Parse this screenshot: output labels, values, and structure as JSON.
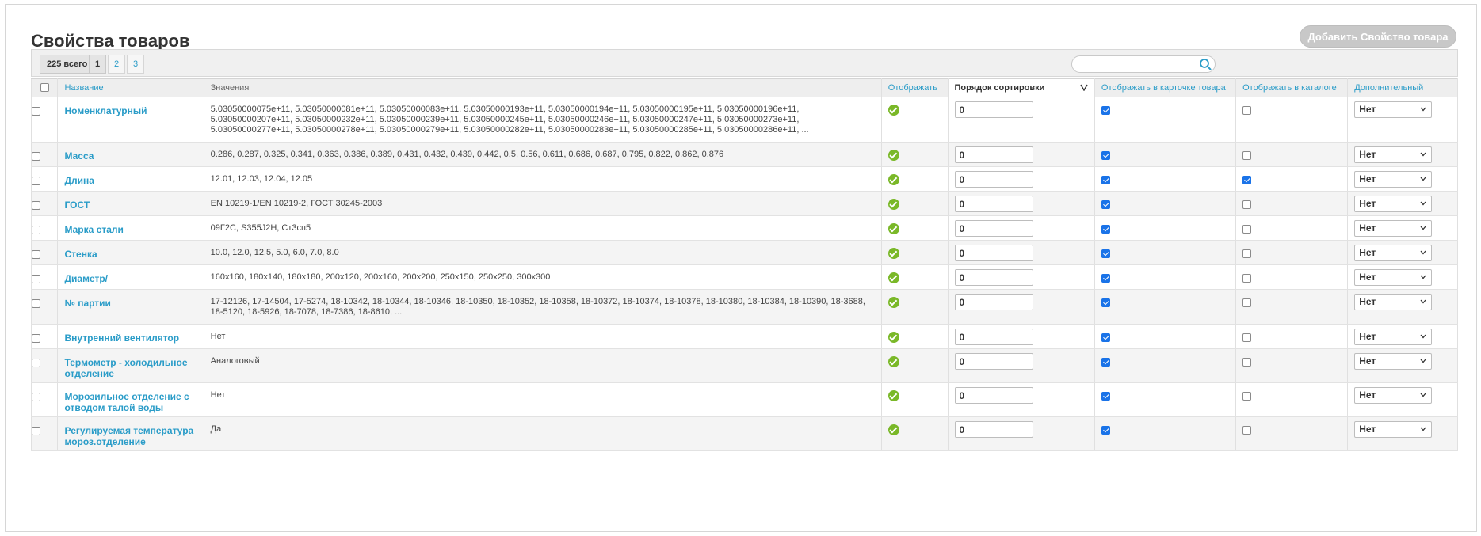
{
  "page": {
    "title": "Свойства товаров",
    "add_button": "Добавить Свойство товара"
  },
  "toolbar": {
    "total": "225 всего",
    "pages": [
      "1",
      "2",
      "3"
    ],
    "active_page": "1",
    "search_placeholder": ""
  },
  "columns": {
    "name": "Название",
    "values": "Значения",
    "show": "Отображать",
    "sort": "Порядок сортировки",
    "card": "Отображать в карточке товара",
    "catalog": "Отображать в каталоге",
    "extra": "Дополнительный"
  },
  "colors": {
    "link": "#2a9cc8",
    "ok": "#7ab828",
    "checkbox": "#1a73e8"
  },
  "rows": [
    {
      "name": [
        "Номенклатурный"
      ],
      "values": [
        "5.03050000075e+11, 5.03050000081e+11, 5.03050000083e+11, 5.03050000193e+11, 5.03050000194e+11, 5.03050000195e+11, 5.03050000196e+11,",
        "5.03050000207e+11, 5.03050000232e+11, 5.03050000239e+11, 5.03050000245e+11, 5.03050000246e+11, 5.03050000247e+11, 5.03050000273e+11,",
        "5.03050000277e+11, 5.03050000278e+11, 5.03050000279e+11, 5.03050000282e+11, 5.03050000283e+11, 5.03050000285e+11, 5.03050000286e+11, ..."
      ],
      "sort": "0",
      "card": true,
      "catalog": false,
      "extra": "Нет"
    },
    {
      "name": [
        "Масса"
      ],
      "values": [
        "0.286, 0.287, 0.325, 0.341, 0.363, 0.386, 0.389, 0.431, 0.432, 0.439, 0.442, 0.5, 0.56, 0.611, 0.686, 0.687, 0.795, 0.822, 0.862, 0.876"
      ],
      "sort": "0",
      "card": true,
      "catalog": false,
      "extra": "Нет"
    },
    {
      "name": [
        "Длина"
      ],
      "values": [
        "12.01, 12.03, 12.04, 12.05"
      ],
      "sort": "0",
      "card": true,
      "catalog": true,
      "extra": "Нет"
    },
    {
      "name": [
        "ГОСТ"
      ],
      "values": [
        "EN 10219-1/EN 10219-2, ГОСТ 30245-2003"
      ],
      "sort": "0",
      "card": true,
      "catalog": false,
      "extra": "Нет"
    },
    {
      "name": [
        "Марка стали"
      ],
      "values": [
        "09Г2С, S355J2H, Ст3сп5"
      ],
      "sort": "0",
      "card": true,
      "catalog": false,
      "extra": "Нет"
    },
    {
      "name": [
        "Стенка"
      ],
      "values": [
        "10.0, 12.0, 12.5, 5.0, 6.0, 7.0, 8.0"
      ],
      "sort": "0",
      "card": true,
      "catalog": false,
      "extra": "Нет"
    },
    {
      "name": [
        "Диаметр/"
      ],
      "values": [
        "160x160, 180x140, 180x180, 200x120, 200x160, 200x200, 250x150, 250x250, 300x300"
      ],
      "sort": "0",
      "card": true,
      "catalog": false,
      "extra": "Нет"
    },
    {
      "name": [
        "№ партии"
      ],
      "values": [
        "17-12126, 17-14504, 17-5274, 18-10342, 18-10344, 18-10346, 18-10350, 18-10352, 18-10358, 18-10372, 18-10374, 18-10378, 18-10380, 18-10384, 18-10390, 18-3688,",
        "18-5120, 18-5926, 18-7078, 18-7386, 18-8610, ..."
      ],
      "sort": "0",
      "card": true,
      "catalog": false,
      "extra": "Нет"
    },
    {
      "name": [
        "Внутренний вентилятор"
      ],
      "values": [
        "Нет"
      ],
      "sort": "0",
      "card": true,
      "catalog": false,
      "extra": "Нет"
    },
    {
      "name": [
        "Термометр - холодильное",
        "отделение"
      ],
      "values": [
        "Аналоговый"
      ],
      "sort": "0",
      "card": true,
      "catalog": false,
      "extra": "Нет"
    },
    {
      "name": [
        "Морозильное отделение с",
        "отводом талой воды"
      ],
      "values": [
        "Нет"
      ],
      "sort": "0",
      "card": true,
      "catalog": false,
      "extra": "Нет"
    },
    {
      "name": [
        "Регулируемая температура",
        "мороз.отделение"
      ],
      "values": [
        "Да"
      ],
      "sort": "0",
      "card": true,
      "catalog": false,
      "extra": "Нет"
    }
  ]
}
